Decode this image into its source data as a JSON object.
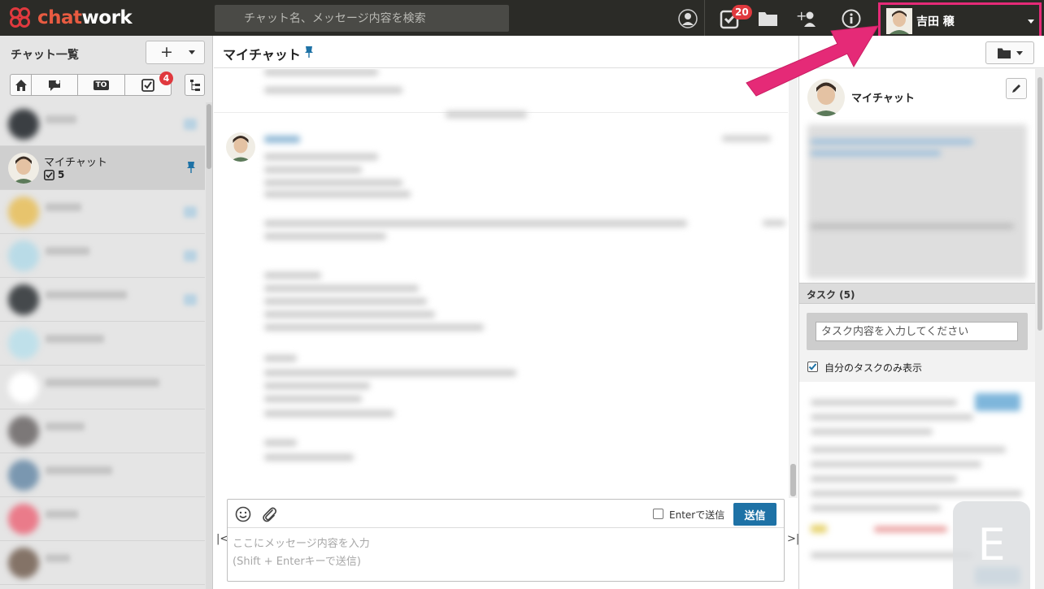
{
  "app": {
    "logo_text_1": "chat",
    "logo_text_2": "work",
    "brand_color": "#e0393e"
  },
  "header": {
    "search_placeholder": "チャット名、メッセージ内容を検索",
    "task_badge": "20",
    "user_name": "吉田 穣",
    "icons": [
      "contact-icon",
      "task-icon",
      "folder-icon",
      "add-contact-icon",
      "info-icon"
    ]
  },
  "sidebar": {
    "title": "チャット一覧",
    "filter_badge": "4",
    "filter_tab_labels": [
      "TO"
    ],
    "active_room": {
      "name": "マイチャット",
      "task_count": "5"
    }
  },
  "chat": {
    "title": "マイチャット",
    "enter_to_send_label": "Enterで送信",
    "send_label": "送信",
    "composer_placeholder": "ここにメッセージ内容を入力\n(Shift + Enterキーで送信)"
  },
  "room_panel": {
    "room_name": "マイチャット",
    "task_section_title": "タスク (5)",
    "task_input_placeholder": "タスク内容を入力してください",
    "only_my_tasks_label": "自分のタスクのみ表示",
    "only_my_tasks_checked": true
  },
  "overlay": {
    "watermark_letter": "E",
    "arrow_color": "#e52a77"
  }
}
